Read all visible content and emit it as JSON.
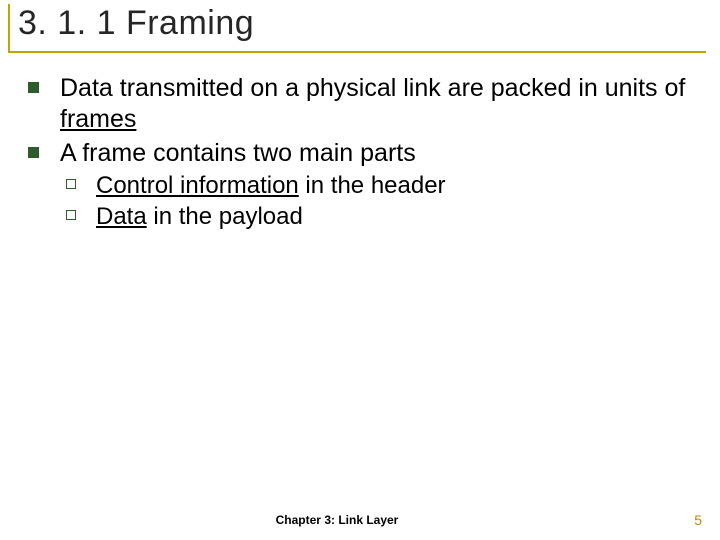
{
  "title": "3. 1. 1 Framing",
  "bullets": {
    "b1_prefix": "Data transmitted on a physical link are packed in units of ",
    "b1_underlined": "frames",
    "b2": "A frame contains two main parts",
    "s1_underlined": "Control information",
    "s1_rest": " in the header",
    "s2_underlined": "Data",
    "s2_rest": " in the payload"
  },
  "footer": {
    "chapter": "Chapter 3: Link Layer",
    "page": "5"
  }
}
